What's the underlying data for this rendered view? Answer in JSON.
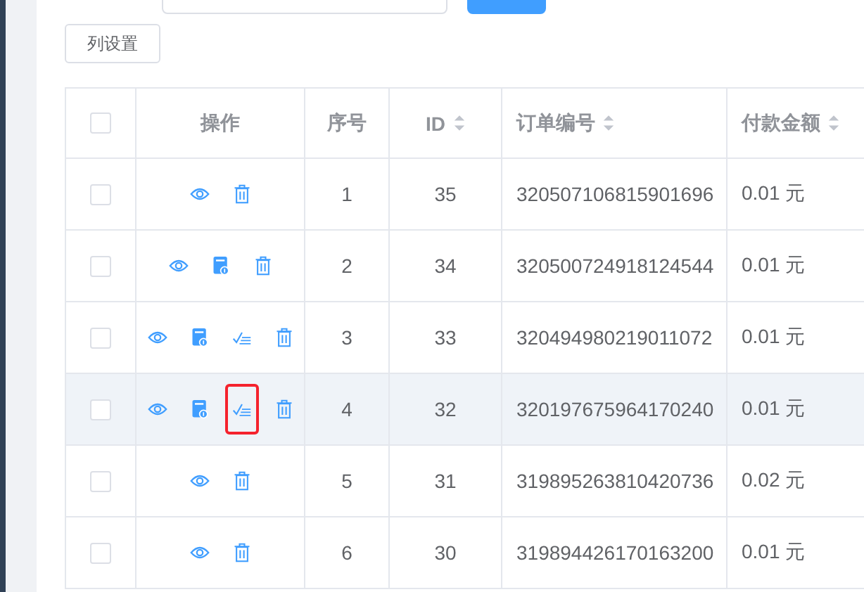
{
  "toolbar": {
    "column_settings_button": "列设置"
  },
  "table": {
    "columns": [
      {
        "label": "操作",
        "sortable": false
      },
      {
        "label": "序号",
        "sortable": false
      },
      {
        "label": "ID",
        "sortable": true
      },
      {
        "label": "订单编号",
        "sortable": true
      },
      {
        "label": "付款金额",
        "sortable": true
      }
    ],
    "header_checked": false,
    "rows": [
      {
        "checked": false,
        "hovered": false,
        "index": "1",
        "id": "35",
        "order_no": "320507106815901696",
        "amount": "0.01 元",
        "actions": [
          {
            "kind": "view",
            "marked": false
          },
          {
            "kind": "delete",
            "marked": false
          }
        ]
      },
      {
        "checked": false,
        "hovered": false,
        "index": "2",
        "id": "34",
        "order_no": "320500724918124544",
        "amount": "0.01 元",
        "actions": [
          {
            "kind": "view",
            "marked": false
          },
          {
            "kind": "invoice",
            "marked": false
          },
          {
            "kind": "delete",
            "marked": false
          }
        ]
      },
      {
        "checked": false,
        "hovered": false,
        "index": "3",
        "id": "33",
        "order_no": "320494980219011072",
        "amount": "0.01 元",
        "actions": [
          {
            "kind": "view",
            "marked": false
          },
          {
            "kind": "invoice",
            "marked": false
          },
          {
            "kind": "check",
            "marked": false
          },
          {
            "kind": "delete",
            "marked": false
          }
        ]
      },
      {
        "checked": false,
        "hovered": true,
        "index": "4",
        "id": "32",
        "order_no": "320197675964170240",
        "amount": "0.01 元",
        "actions": [
          {
            "kind": "view",
            "marked": false
          },
          {
            "kind": "invoice",
            "marked": false
          },
          {
            "kind": "check",
            "marked": true
          },
          {
            "kind": "delete",
            "marked": false
          }
        ]
      },
      {
        "checked": false,
        "hovered": false,
        "index": "5",
        "id": "31",
        "order_no": "319895263810420736",
        "amount": "0.02 元",
        "actions": [
          {
            "kind": "view",
            "marked": false
          },
          {
            "kind": "delete",
            "marked": false
          }
        ]
      },
      {
        "checked": false,
        "hovered": false,
        "index": "6",
        "id": "30",
        "order_no": "319894426170163200",
        "amount": "0.01 元",
        "actions": [
          {
            "kind": "view",
            "marked": false
          },
          {
            "kind": "delete",
            "marked": false
          }
        ]
      }
    ]
  }
}
